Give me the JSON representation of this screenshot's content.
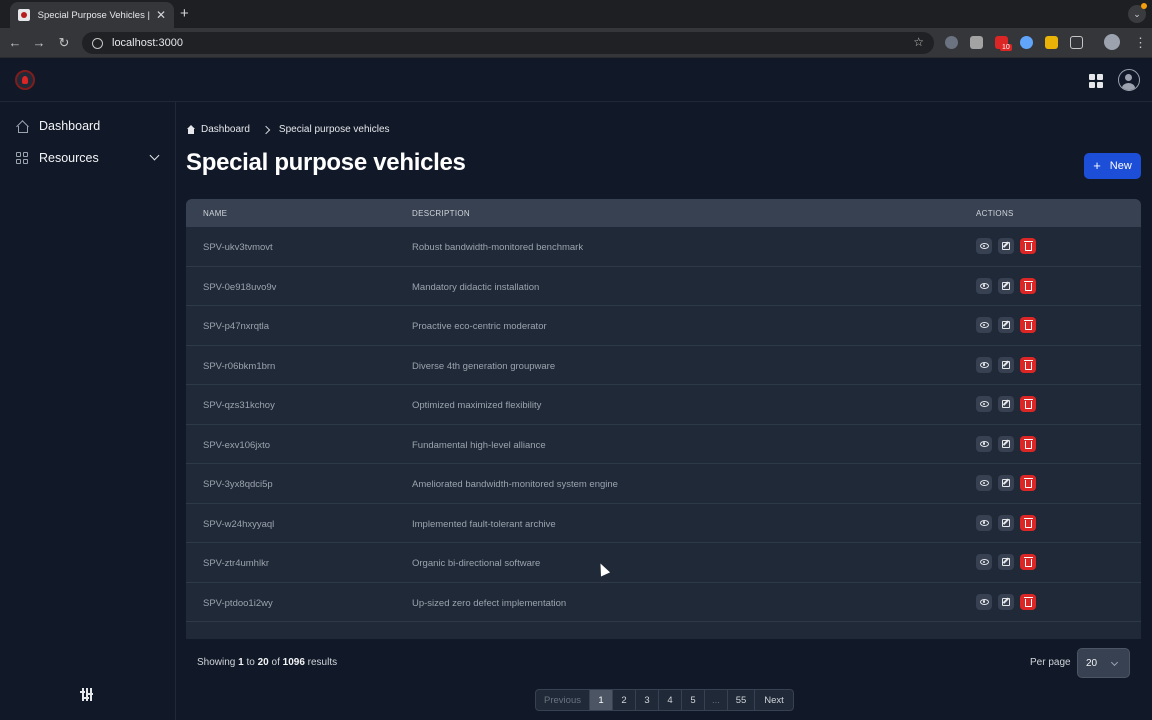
{
  "browser": {
    "tab_title": "Special Purpose Vehicles | Ta",
    "tab_close": "✕",
    "new_tab": "+",
    "url": "localhost:3000",
    "back": "←",
    "forward": "→",
    "reload": "↻",
    "bookmark": "☆",
    "tab_menu": "⌄",
    "extension_badge": "10"
  },
  "sidebar": {
    "items": [
      {
        "label": "Dashboard",
        "icon": "home-icon"
      },
      {
        "label": "Resources",
        "icon": "grid-icon"
      }
    ]
  },
  "breadcrumb": {
    "home": "Dashboard",
    "current": "Special purpose vehicles"
  },
  "page": {
    "title": "Special purpose vehicles",
    "new_button": "New",
    "new_icon": "+"
  },
  "table": {
    "headers": [
      "NAME",
      "DESCRIPTION",
      "ACTIONS"
    ],
    "rows": [
      {
        "name": "SPV-ukv3tvmovt",
        "description": "Robust bandwidth-monitored benchmark"
      },
      {
        "name": "SPV-0e918uvo9v",
        "description": "Mandatory didactic installation"
      },
      {
        "name": "SPV-p47nxrqtla",
        "description": "Proactive eco-centric moderator"
      },
      {
        "name": "SPV-r06bkm1brn",
        "description": "Diverse 4th generation groupware"
      },
      {
        "name": "SPV-qzs31kchoy",
        "description": "Optimized maximized flexibility"
      },
      {
        "name": "SPV-exv106jxto",
        "description": "Fundamental high-level alliance"
      },
      {
        "name": "SPV-3yx8qdci5p",
        "description": "Ameliorated bandwidth-monitored system engine"
      },
      {
        "name": "SPV-w24hxyyaql",
        "description": "Implemented fault-tolerant archive"
      },
      {
        "name": "SPV-ztr4umhlkr",
        "description": "Organic bi-directional software"
      },
      {
        "name": "SPV-ptdoo1i2wy",
        "description": "Up-sized zero defect implementation"
      }
    ]
  },
  "footer": {
    "showing_prefix": "Showing ",
    "from": "1",
    "to_word": " to ",
    "to": "20",
    "of_word": " of ",
    "total": "1096",
    "results_word": " results",
    "per_page_label": "Per page",
    "per_page_value": "20"
  },
  "pagination": {
    "previous": "Previous",
    "pages": [
      "1",
      "2",
      "3",
      "4",
      "5",
      "...",
      "55"
    ],
    "next": "Next",
    "active": "1"
  },
  "colors": {
    "accent": "#1d4ed8",
    "danger": "#dc2626",
    "background": "#111827"
  }
}
